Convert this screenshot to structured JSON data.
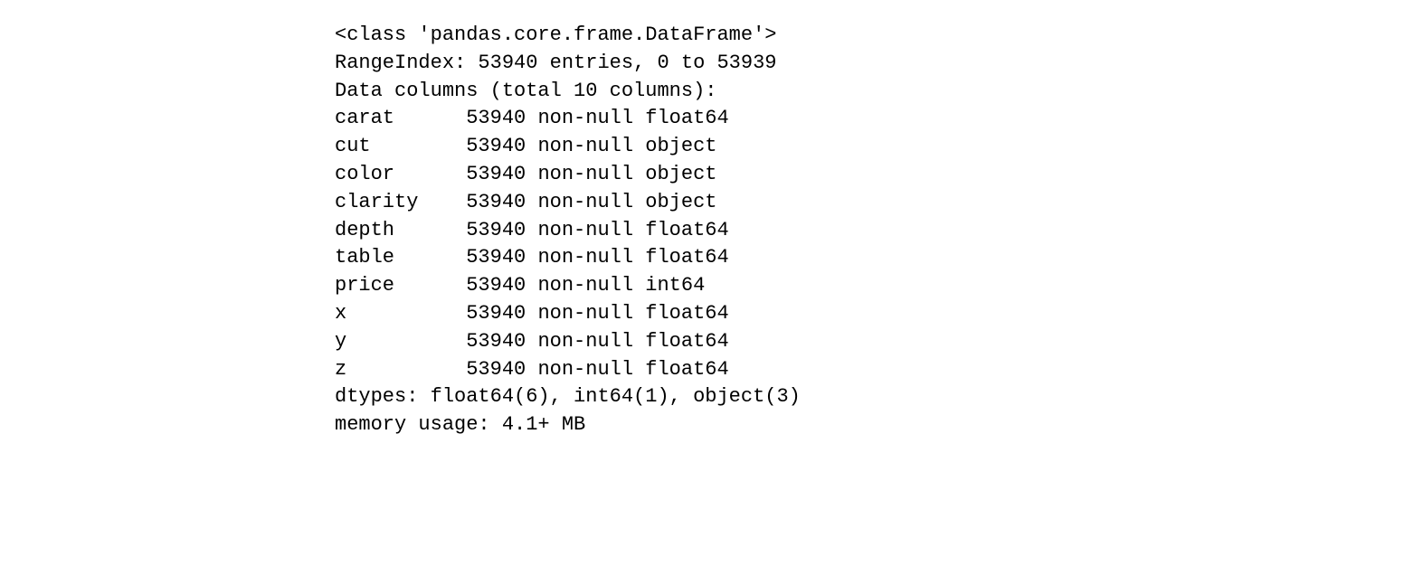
{
  "df_info": {
    "class_line": "<class 'pandas.core.frame.DataFrame'>",
    "range_index": "RangeIndex: 53940 entries, 0 to 53939",
    "data_columns_header": "Data columns (total 10 columns):",
    "columns": [
      {
        "name": "carat",
        "pad": "carat      ",
        "count": "53940",
        "dtype": "float64"
      },
      {
        "name": "cut",
        "pad": "cut        ",
        "count": "53940",
        "dtype": "object"
      },
      {
        "name": "color",
        "pad": "color      ",
        "count": "53940",
        "dtype": "object"
      },
      {
        "name": "clarity",
        "pad": "clarity    ",
        "count": "53940",
        "dtype": "object"
      },
      {
        "name": "depth",
        "pad": "depth      ",
        "count": "53940",
        "dtype": "float64"
      },
      {
        "name": "table",
        "pad": "table      ",
        "count": "53940",
        "dtype": "float64"
      },
      {
        "name": "price",
        "pad": "price      ",
        "count": "53940",
        "dtype": "int64"
      },
      {
        "name": "x",
        "pad": "x          ",
        "count": "53940",
        "dtype": "float64"
      },
      {
        "name": "y",
        "pad": "y          ",
        "count": "53940",
        "dtype": "float64"
      },
      {
        "name": "z",
        "pad": "z          ",
        "count": "53940",
        "dtype": "float64"
      }
    ],
    "dtypes_summary": "dtypes: float64(6), int64(1), object(3)",
    "memory_usage": "memory usage: 4.1+ MB"
  }
}
